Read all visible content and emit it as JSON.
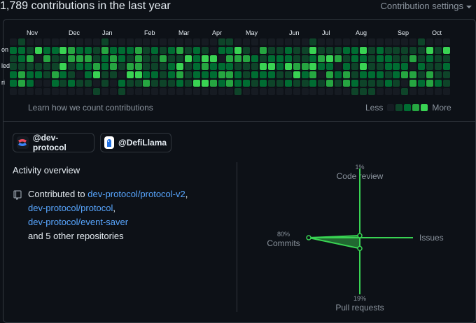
{
  "header": {
    "title": "1,789 contributions in the last year",
    "settings_label": "Contribution settings"
  },
  "calendar": {
    "months": [
      "Nov",
      "Dec",
      "Jan",
      "Feb",
      "Mar",
      "Apr",
      "May",
      "Jun",
      "Jul",
      "Aug",
      "Sep",
      "Oct"
    ],
    "day_labels": [
      "on",
      "led",
      "ri"
    ],
    "palette": [
      "#161b22",
      "#0e4429",
      "#006d32",
      "#26a641",
      "#39d353"
    ],
    "weeks": 53,
    "seed": 7
  },
  "footer": {
    "learn_text": "Learn how we count contributions",
    "less": "Less",
    "more": "More"
  },
  "orgs": [
    {
      "label": "@dev-protocol",
      "icon": "dev-protocol-logo"
    },
    {
      "label": "@DefiLlama",
      "icon": "defillama-logo"
    }
  ],
  "activity": {
    "title": "Activity overview",
    "prefix": "Contributed to ",
    "repos": [
      "dev-protocol/protocol-v2",
      "dev-protocol/protocol",
      "dev-protocol/event-saver"
    ],
    "suffix": "and 5 other repositories"
  },
  "radar": {
    "code_review": {
      "label": "Code review",
      "pct": "1%",
      "value": 1
    },
    "issues": {
      "label": "Issues",
      "pct": "",
      "value": 0
    },
    "pull_requests": {
      "label": "Pull requests",
      "pct": "19%",
      "value": 19
    },
    "commits": {
      "label": "Commits",
      "pct": "80%",
      "value": 80
    },
    "color": "#39d353"
  }
}
